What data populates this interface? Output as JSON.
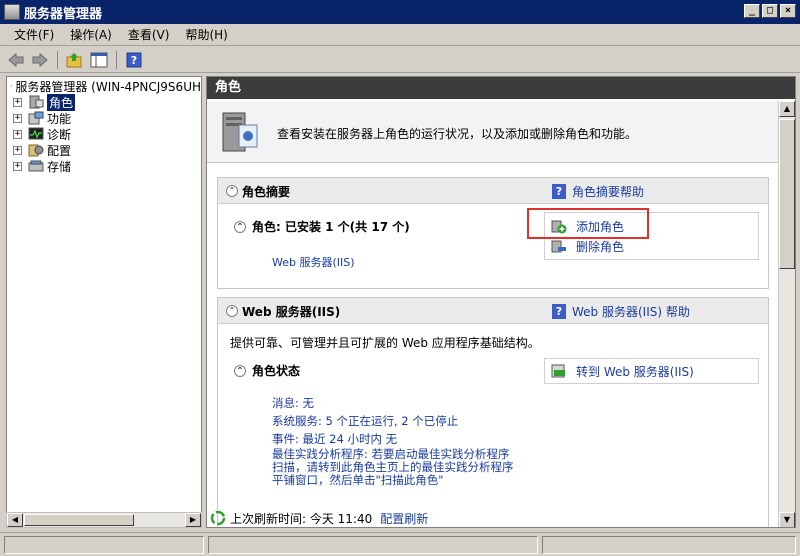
{
  "window": {
    "title": "服务器管理器",
    "controls": [
      "_",
      "□",
      "×"
    ]
  },
  "menu": [
    {
      "label": "文件(F)"
    },
    {
      "label": "操作(A)"
    },
    {
      "label": "查看(V)"
    },
    {
      "label": "帮助(H)"
    }
  ],
  "toolbar": {
    "icons": [
      "back-icon",
      "forward-icon",
      "up-folder-icon",
      "show-hide-tree-icon",
      "help-icon"
    ]
  },
  "tree": {
    "root": "服务器管理器 (WIN-4PNCJ9S6UH",
    "items": [
      {
        "label": "角色",
        "selected": true,
        "icon": "roles-icon"
      },
      {
        "label": "功能",
        "icon": "features-icon"
      },
      {
        "label": "诊断",
        "icon": "diagnostics-icon"
      },
      {
        "label": "配置",
        "icon": "configuration-icon"
      },
      {
        "label": "存储",
        "icon": "storage-icon"
      }
    ]
  },
  "content": {
    "header": "角色",
    "intro_text": "查看安装在服务器上角色的运行状况，以及添加或删除角色和功能。",
    "role_summary": {
      "title": "角色摘要",
      "help_link": "角色摘要帮助",
      "roles_line": "角色: 已安装 1 个(共 17 个)",
      "installed_role": "Web 服务器(IIS)",
      "tasks": [
        "添加角色",
        "删除角色"
      ]
    },
    "web_server": {
      "title": "Web 服务器(IIS)",
      "help_link": "Web 服务器(IIS) 帮助",
      "description": "提供可靠、可管理并且可扩展的 Web 应用程序基础结构。",
      "status_title": "角色状态",
      "goto_task": "转到 Web 服务器(IIS)",
      "details": [
        "消息: 无",
        "系统服务: 5 个正在运行, 2 个已停止",
        "事件: 最近 24 小时内 无",
        "最佳实践分析程序: 若要启动最佳实践分析程序",
        "扫描，请转到此角色主页上的最佳实践分析程序",
        "平铺窗口，然后单击\"扫描此角色\""
      ]
    },
    "refresh": {
      "label": "上次刷新时间: 今天 11:40",
      "action": "配置刷新"
    }
  },
  "colors": {
    "title_bar": "#0a246a",
    "link": "#1a3c9c",
    "highlight_box": "#e03030",
    "header_bar": "#3c3c3c"
  }
}
